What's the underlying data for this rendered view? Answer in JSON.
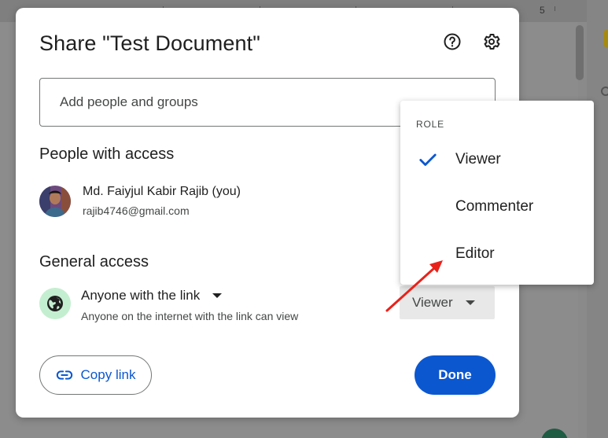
{
  "background": {
    "ruler_number": "5"
  },
  "dialog": {
    "title": "Share \"Test Document\"",
    "add_people_placeholder": "Add people and groups",
    "people_section_title": "People with access",
    "person": {
      "name": "Md. Faiyjul Kabir Rajib (you)",
      "email": "rajib4746@gmail.com"
    },
    "general_section_title": "General access",
    "general_access": {
      "selected": "Anyone with the link",
      "description": "Anyone on the internet with the link can view",
      "role": "Viewer"
    },
    "copy_link_label": "Copy link",
    "done_label": "Done"
  },
  "role_menu": {
    "header": "ROLE",
    "items": [
      {
        "label": "Viewer",
        "selected": true
      },
      {
        "label": "Commenter",
        "selected": false
      },
      {
        "label": "Editor",
        "selected": false
      }
    ]
  },
  "colors": {
    "primary": "#0b57d0",
    "globe_bg": "#c4eed0",
    "annotation_arrow": "#e8221b"
  }
}
